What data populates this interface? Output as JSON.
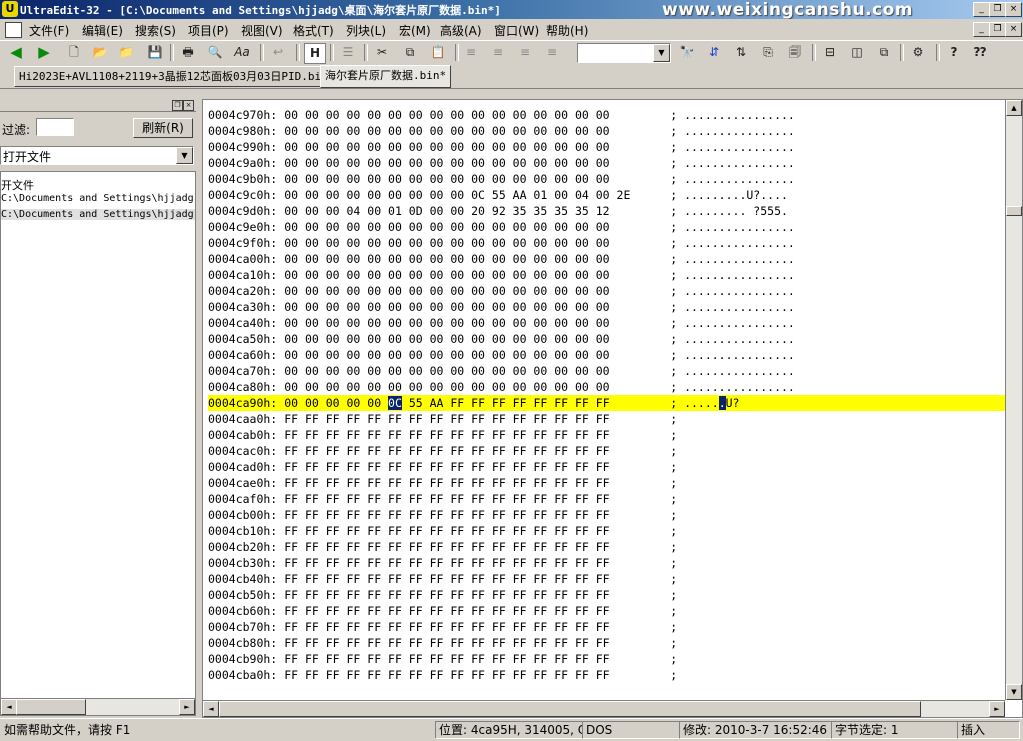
{
  "window": {
    "app_icon_letter": "U",
    "title": "UltraEdit-32 - [C:\\Documents and Settings\\hjjadg\\桌面\\海尔套片原厂数据.bin*]",
    "watermark": "www.weixingcanshu.com",
    "controls": {
      "minimize": "_",
      "restore": "❐",
      "close": "×"
    }
  },
  "menu": [
    "文件(F)",
    "编辑(E)",
    "搜索(S)",
    "项目(P)",
    "视图(V)",
    "格式(T)",
    "列块(L)",
    "宏(M)",
    "高级(A)",
    "窗口(W)",
    "帮助(H)"
  ],
  "menu_controls": {
    "minimize": "_",
    "restore": "❐",
    "close": "×"
  },
  "toolbar": {
    "hex_mode_label": "H",
    "font_label": "Aa",
    "search_combo_value": "",
    "combo_arrow": "▼"
  },
  "tabs": [
    {
      "label": "Hi2023E+AVL1108+2119+3晶振12芯面板03月03日PID.bin",
      "active": false
    },
    {
      "label": "海尔套片原厂数据.bin*",
      "active": true
    }
  ],
  "left_panel": {
    "panel_buttons": {
      "restore": "❐",
      "close": "×"
    },
    "filter_label": "过滤:",
    "filter_value": "",
    "refresh_button": "刷新(R)",
    "open_files_select": "打开文件",
    "select_arrow": "▼",
    "list_header": "开文件",
    "files": [
      "C:\\Documents and Settings\\hjjadg",
      "C:\\Documents and Settings\\hjjadg"
    ],
    "scroll_left": "◄",
    "scroll_right": "►"
  },
  "hex": {
    "lines": [
      {
        "addr": "0004c970h:",
        "bytes": "00 00 00 00 00 00 00 00 00 00 00 00 00 00 00 00",
        "ascii": "................"
      },
      {
        "addr": "0004c980h:",
        "bytes": "00 00 00 00 00 00 00 00 00 00 00 00 00 00 00 00",
        "ascii": "................"
      },
      {
        "addr": "0004c990h:",
        "bytes": "00 00 00 00 00 00 00 00 00 00 00 00 00 00 00 00",
        "ascii": "................"
      },
      {
        "addr": "0004c9a0h:",
        "bytes": "00 00 00 00 00 00 00 00 00 00 00 00 00 00 00 00",
        "ascii": "................"
      },
      {
        "addr": "0004c9b0h:",
        "bytes": "00 00 00 00 00 00 00 00 00 00 00 00 00 00 00 00",
        "ascii": "................"
      },
      {
        "addr": "0004c9c0h:",
        "bytes": "00 00 00 00 00 00 00 00 00 0C 55 AA 01 00 04 00 2E",
        "ascii": ".........U?...."
      },
      {
        "addr": "0004c9d0h:",
        "bytes": "00 00 00 04 00 01 0D 00 00 20 92 35 35 35 35 12",
        "ascii": "......... ?555."
      },
      {
        "addr": "0004c9e0h:",
        "bytes": "00 00 00 00 00 00 00 00 00 00 00 00 00 00 00 00",
        "ascii": "................"
      },
      {
        "addr": "0004c9f0h:",
        "bytes": "00 00 00 00 00 00 00 00 00 00 00 00 00 00 00 00",
        "ascii": "................"
      },
      {
        "addr": "0004ca00h:",
        "bytes": "00 00 00 00 00 00 00 00 00 00 00 00 00 00 00 00",
        "ascii": "................"
      },
      {
        "addr": "0004ca10h:",
        "bytes": "00 00 00 00 00 00 00 00 00 00 00 00 00 00 00 00",
        "ascii": "................"
      },
      {
        "addr": "0004ca20h:",
        "bytes": "00 00 00 00 00 00 00 00 00 00 00 00 00 00 00 00",
        "ascii": "................"
      },
      {
        "addr": "0004ca30h:",
        "bytes": "00 00 00 00 00 00 00 00 00 00 00 00 00 00 00 00",
        "ascii": "................"
      },
      {
        "addr": "0004ca40h:",
        "bytes": "00 00 00 00 00 00 00 00 00 00 00 00 00 00 00 00",
        "ascii": "................"
      },
      {
        "addr": "0004ca50h:",
        "bytes": "00 00 00 00 00 00 00 00 00 00 00 00 00 00 00 00",
        "ascii": "................"
      },
      {
        "addr": "0004ca60h:",
        "bytes": "00 00 00 00 00 00 00 00 00 00 00 00 00 00 00 00",
        "ascii": "................"
      },
      {
        "addr": "0004ca70h:",
        "bytes": "00 00 00 00 00 00 00 00 00 00 00 00 00 00 00 00",
        "ascii": "................"
      },
      {
        "addr": "0004ca80h:",
        "bytes": "00 00 00 00 00 00 00 00 00 00 00 00 00 00 00 00",
        "ascii": "................"
      }
    ],
    "highlight_line": {
      "addr": "0004ca90h:",
      "bytes_before": "00 00 00 00 00 ",
      "selected_byte": "0C",
      "bytes_after": " 55 AA FF FF FF FF FF FF FF FF",
      "ascii_before": ".....",
      "ascii_selected": ".",
      "ascii_after": "U?"
    },
    "ff_lines": [
      {
        "addr": "0004caa0h:",
        "bytes": "FF FF FF FF FF FF FF FF FF FF FF FF FF FF FF FF",
        "ascii": ""
      },
      {
        "addr": "0004cab0h:",
        "bytes": "FF FF FF FF FF FF FF FF FF FF FF FF FF FF FF FF",
        "ascii": ""
      },
      {
        "addr": "0004cac0h:",
        "bytes": "FF FF FF FF FF FF FF FF FF FF FF FF FF FF FF FF",
        "ascii": ""
      },
      {
        "addr": "0004cad0h:",
        "bytes": "FF FF FF FF FF FF FF FF FF FF FF FF FF FF FF FF",
        "ascii": ""
      },
      {
        "addr": "0004cae0h:",
        "bytes": "FF FF FF FF FF FF FF FF FF FF FF FF FF FF FF FF",
        "ascii": ""
      },
      {
        "addr": "0004caf0h:",
        "bytes": "FF FF FF FF FF FF FF FF FF FF FF FF FF FF FF FF",
        "ascii": ""
      },
      {
        "addr": "0004cb00h:",
        "bytes": "FF FF FF FF FF FF FF FF FF FF FF FF FF FF FF FF",
        "ascii": ""
      },
      {
        "addr": "0004cb10h:",
        "bytes": "FF FF FF FF FF FF FF FF FF FF FF FF FF FF FF FF",
        "ascii": ""
      },
      {
        "addr": "0004cb20h:",
        "bytes": "FF FF FF FF FF FF FF FF FF FF FF FF FF FF FF FF",
        "ascii": ""
      },
      {
        "addr": "0004cb30h:",
        "bytes": "FF FF FF FF FF FF FF FF FF FF FF FF FF FF FF FF",
        "ascii": ""
      },
      {
        "addr": "0004cb40h:",
        "bytes": "FF FF FF FF FF FF FF FF FF FF FF FF FF FF FF FF",
        "ascii": ""
      },
      {
        "addr": "0004cb50h:",
        "bytes": "FF FF FF FF FF FF FF FF FF FF FF FF FF FF FF FF",
        "ascii": ""
      },
      {
        "addr": "0004cb60h:",
        "bytes": "FF FF FF FF FF FF FF FF FF FF FF FF FF FF FF FF",
        "ascii": ""
      },
      {
        "addr": "0004cb70h:",
        "bytes": "FF FF FF FF FF FF FF FF FF FF FF FF FF FF FF FF",
        "ascii": ""
      },
      {
        "addr": "0004cb80h:",
        "bytes": "FF FF FF FF FF FF FF FF FF FF FF FF FF FF FF FF",
        "ascii": ""
      },
      {
        "addr": "0004cb90h:",
        "bytes": "FF FF FF FF FF FF FF FF FF FF FF FF FF FF FF FF",
        "ascii": ""
      },
      {
        "addr": "0004cba0h:",
        "bytes": "FF FF FF FF FF FF FF FF FF FF FF FF FF FF FF FF",
        "ascii": ""
      }
    ],
    "separator": ";",
    "scroll_up": "▲",
    "scroll_down": "▼",
    "scroll_left": "◄",
    "scroll_right": "►"
  },
  "status": {
    "help": "如需帮助文件，请按 F1",
    "position": "位置: 4ca95H, 314005, C0",
    "line_ending": "DOS",
    "modified": "修改: 2010-3-7 16:52:46",
    "selected_bytes": "字节选定: 1",
    "insert_mode": "插入"
  },
  "colors": {
    "highlight_line": "#ffff00",
    "selection": "#0a246a",
    "title_gradient_start": "#0a246a"
  }
}
